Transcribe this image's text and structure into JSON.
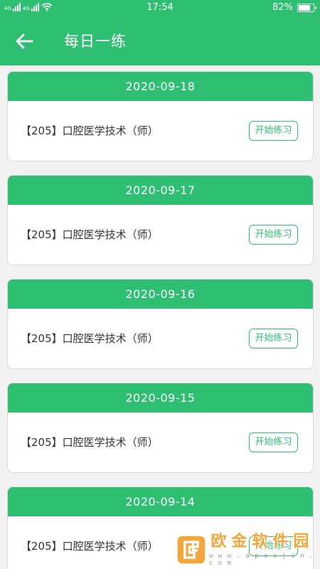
{
  "status_bar": {
    "network_1": "4G",
    "network_2": "4G",
    "time": "17:54",
    "battery_percent": "82%",
    "battery_level": 0.82
  },
  "app_bar": {
    "title": "每日一练",
    "back_icon": "arrow-left-icon"
  },
  "cards": [
    {
      "date": "2020-09-18",
      "subject": "【205】口腔医学技术（师）",
      "button": "开始练习"
    },
    {
      "date": "2020-09-17",
      "subject": "【205】口腔医学技术（师）",
      "button": "开始练习"
    },
    {
      "date": "2020-09-16",
      "subject": "【205】口腔医学技术（师）",
      "button": "开始练习"
    },
    {
      "date": "2020-09-15",
      "subject": "【205】口腔医学技术（师）",
      "button": "开始练习"
    },
    {
      "date": "2020-09-14",
      "subject": "【205】口腔医学技术（师）",
      "button": "开始练习"
    }
  ],
  "watermark": {
    "brand": [
      "欧",
      "金",
      "软",
      "件",
      "园"
    ],
    "url": "w w w . a p o u j i n . c o m"
  },
  "colors": {
    "primary": "#2fbf73",
    "background": "#f2f2f2",
    "watermark_orange": "#f3a63b"
  }
}
